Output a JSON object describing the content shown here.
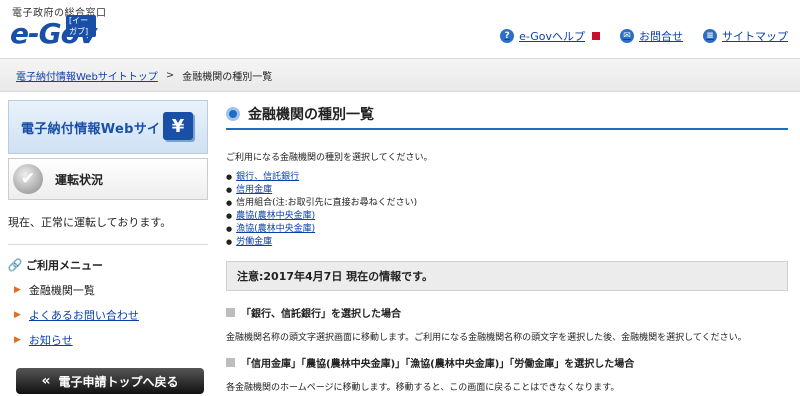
{
  "header": {
    "tagline": "電子政府の総合窓口",
    "logo_text": "e-Gov",
    "logo_sub": "[イーガブ]",
    "nav": [
      {
        "label": "e-Govヘルプ",
        "icon": "help-icon"
      },
      {
        "label": "お問合せ",
        "icon": "mail-icon"
      },
      {
        "label": "サイトマップ",
        "icon": "sitemap-icon"
      }
    ]
  },
  "breadcrumb": {
    "home": "電子納付情報Webサイトトップ",
    "separator": ">",
    "current": "金融機関の種別一覧"
  },
  "sidebar": {
    "banner": "電子納付情報Webサイト",
    "yen_symbol": "¥",
    "status_title": "運転状況",
    "status_text": "現在、正常に運転しております。",
    "menu_header": "ご利用メニュー",
    "menu_items": [
      {
        "label": "金融機関一覧",
        "current": true
      },
      {
        "label": "よくあるお問い合わせ",
        "current": false
      },
      {
        "label": "お知らせ",
        "current": false
      }
    ],
    "back_button": "電子申請トップへ戻る"
  },
  "main": {
    "title": "金融機関の種別一覧",
    "intro": "ご利用になる金融機関の種別を選択してください。",
    "types": [
      {
        "label": "銀行、信託銀行",
        "link": true
      },
      {
        "label": "信用金庫",
        "link": true
      },
      {
        "label": "信用組合(注:お取引先に直接お尋ねください)",
        "link": false
      },
      {
        "label": "農協(農林中央金庫)",
        "link": true
      },
      {
        "label": "漁協(農林中央金庫)",
        "link": true
      },
      {
        "label": "労働金庫",
        "link": true
      }
    ],
    "notice": "注意:2017年4月7日 現在の情報です。",
    "section1_title": "「銀行、信託銀行」を選択した場合",
    "section1_desc": "金融機関名称の頭文字選択画面に移動します。ご利用になる金融機関名称の頭文字を選択した後、金融機関を選択してください。",
    "section2_title": "「信用金庫」「農協(農林中央金庫)」「漁協(農林中央金庫)」「労働金庫」を選択した場合",
    "section2_desc": "各金融機関のホームページに移動します。移動すると、この画面に戻ることはできなくなります。"
  },
  "colors": {
    "brand_blue": "#1a4fa8",
    "link_blue": "#0a3fa8",
    "accent_orange": "#e07020",
    "external_red": "#c8102e"
  }
}
